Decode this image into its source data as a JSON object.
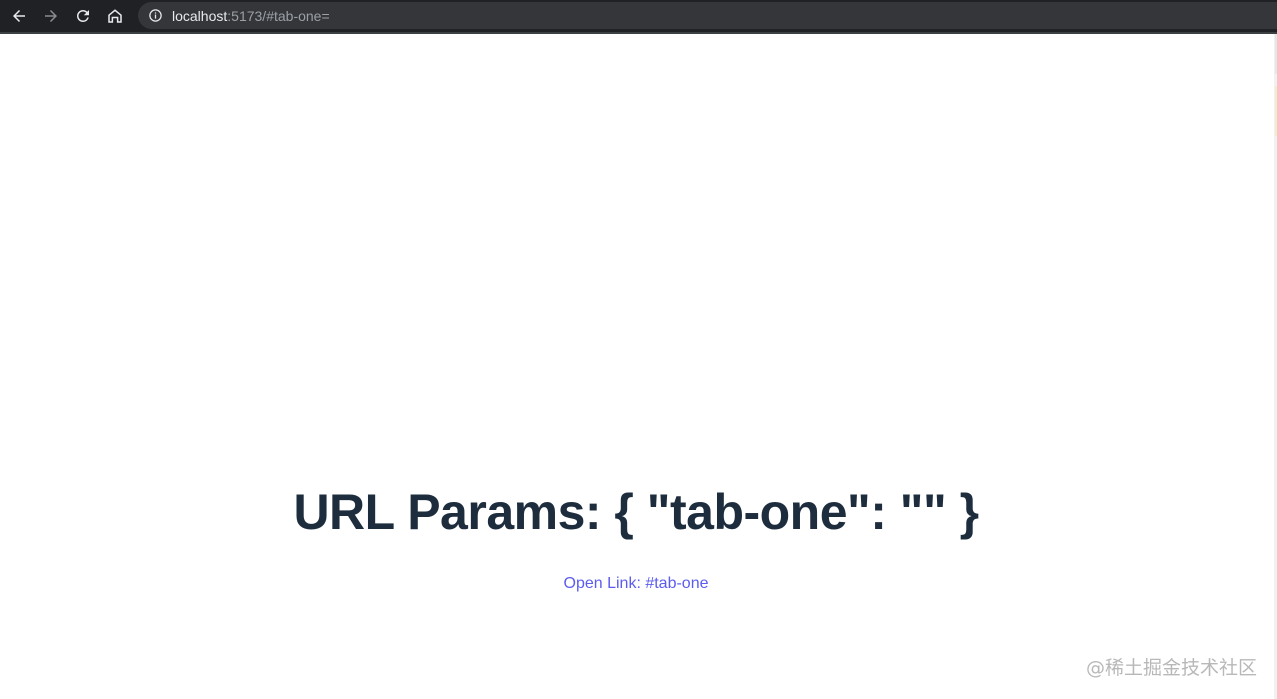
{
  "browser": {
    "url_host": "localhost",
    "url_rest": ":5173/#tab-one=",
    "back_icon": "arrow-left-icon",
    "forward_icon": "arrow-right-icon",
    "reload_icon": "reload-icon",
    "home_icon": "home-icon",
    "info_icon": "info-icon"
  },
  "page": {
    "heading": "URL Params: { \"tab-one\": \"\" }",
    "link_label": "Open Link: #tab-one"
  },
  "watermark": "@稀土掘金技术社区",
  "colors": {
    "toolbar_bg": "#202124",
    "heading": "#1e2d3d",
    "link": "#5c5cf0"
  }
}
